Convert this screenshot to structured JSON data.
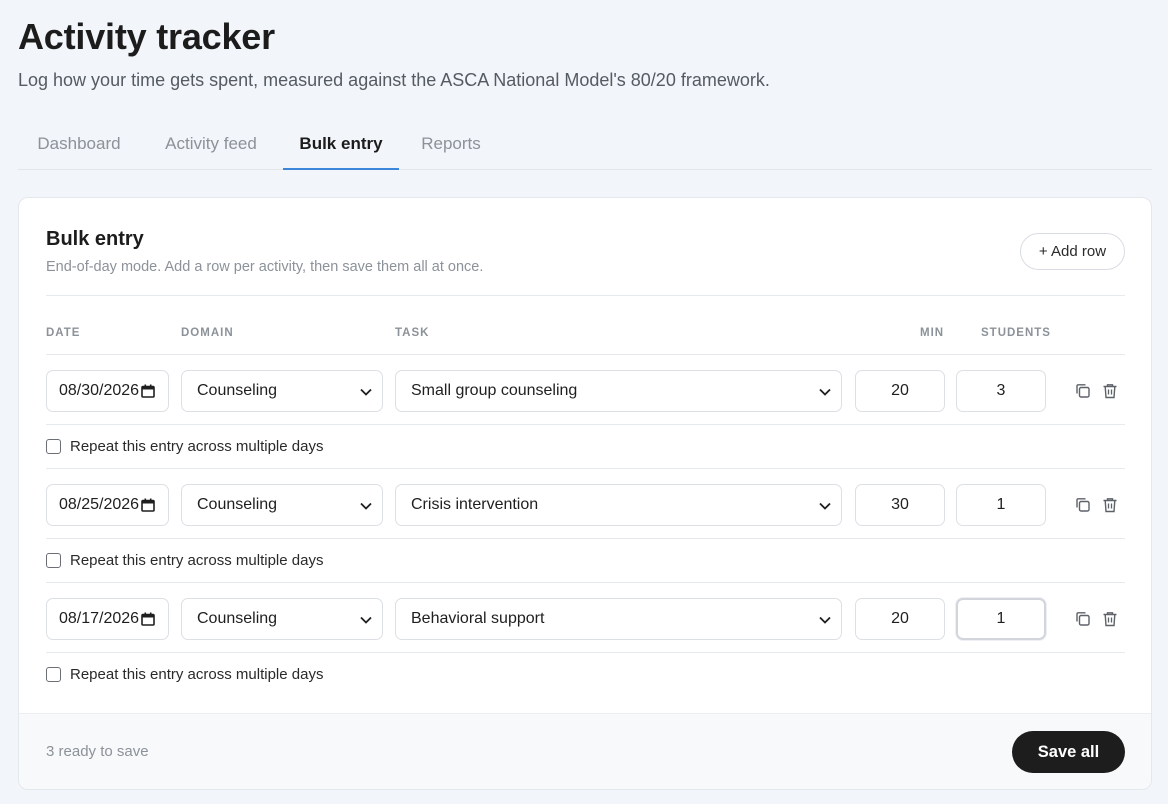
{
  "header": {
    "title": "Activity tracker",
    "subtitle": "Log how your time gets spent, measured against the ASCA National Model's 80/20 framework."
  },
  "tabs": [
    {
      "label": "Dashboard",
      "active": false
    },
    {
      "label": "Activity feed",
      "active": false
    },
    {
      "label": "Bulk entry",
      "active": true
    },
    {
      "label": "Reports",
      "active": false
    }
  ],
  "card": {
    "title": "Bulk entry",
    "description": "End-of-day mode. Add a row per activity, then save them all at once.",
    "add_row_label": "+ Add row"
  },
  "columns": {
    "date": "DATE",
    "domain": "DOMAIN",
    "task": "TASK",
    "min": "MIN",
    "students": "STUDENTS"
  },
  "rows": [
    {
      "date": "08/30/2026",
      "domain": "Counseling",
      "task": "Small group counseling",
      "min": "20",
      "students": "3",
      "repeat_label": "Repeat this entry across multiple days",
      "repeat_checked": false
    },
    {
      "date": "08/25/2026",
      "domain": "Counseling",
      "task": "Crisis intervention",
      "min": "30",
      "students": "1",
      "repeat_label": "Repeat this entry across multiple days",
      "repeat_checked": false
    },
    {
      "date": "08/17/2026",
      "domain": "Counseling",
      "task": "Behavioral support",
      "min": "20",
      "students": "1",
      "repeat_label": "Repeat this entry across multiple days",
      "repeat_checked": false
    }
  ],
  "footer": {
    "status": "3 ready to save",
    "save_label": "Save all"
  },
  "icons": {
    "calendar": "calendar-icon",
    "chevron": "chevron-down-icon",
    "copy": "copy-icon",
    "trash": "trash-icon"
  },
  "colors": {
    "background": "#f2f5f9",
    "active_tab_underline": "#3b86d8",
    "save_button": "#1d1d1d"
  }
}
